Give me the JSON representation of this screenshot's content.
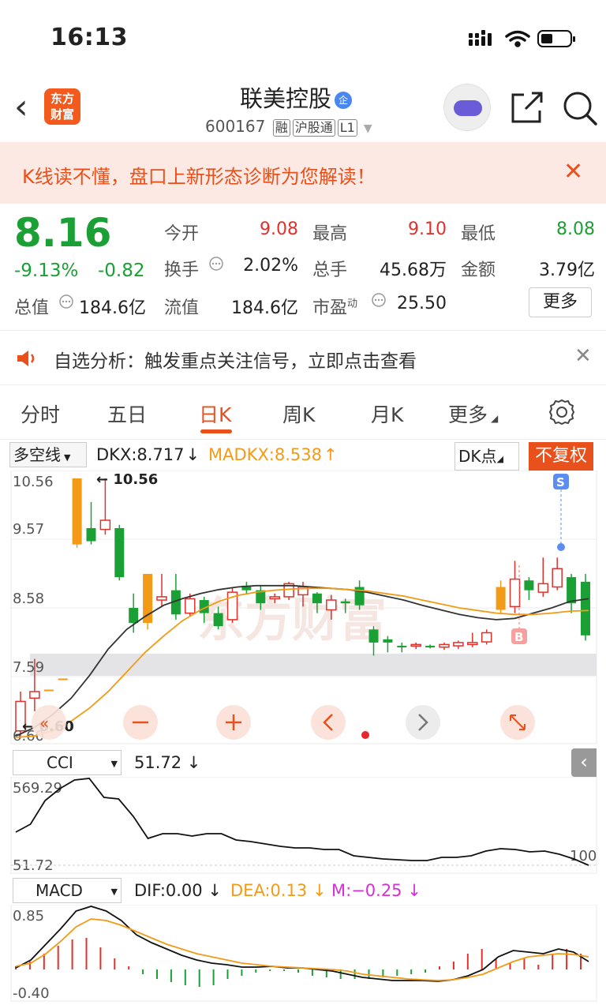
{
  "status": {
    "time": "16:13"
  },
  "nav": {
    "logo_line1": "东方",
    "logo_line2": "财富",
    "stock_name": "联美控股",
    "badge": "企",
    "code": "600167",
    "tags": [
      "融",
      "沪股通",
      "L1"
    ]
  },
  "banner": {
    "text": "K线读不懂，盘口上新形态诊断为您解读！",
    "close": "✕"
  },
  "quote": {
    "price": "8.16",
    "change_pct": "-9.13%",
    "change": "-0.82",
    "market_value_label": "总值",
    "market_value": "184.6亿",
    "fields": [
      {
        "label": "今开",
        "value": "9.08",
        "color": "#e0312b"
      },
      {
        "label": "最高",
        "value": "9.10",
        "color": "#e0312b"
      },
      {
        "label": "最低",
        "value": "8.08",
        "color": "#1aa034"
      },
      {
        "label": "换手",
        "value": "2.02%",
        "color": "#222222"
      },
      {
        "label": "总手",
        "value": "45.68万",
        "color": "#222222"
      },
      {
        "label": "金额",
        "value": "3.79亿",
        "color": "#222222"
      },
      {
        "label": "流值",
        "value": "184.6亿",
        "color": "#222222"
      },
      {
        "label": "市盈",
        "value": "25.50",
        "color": "#222222"
      }
    ],
    "pe_sup": "动",
    "more": "更多"
  },
  "alert": {
    "text": "自选分析：触发重点关注信号，立即点击查看",
    "close": "✕"
  },
  "tabs": [
    "分时",
    "五日",
    "日K",
    "周K",
    "月K",
    "更多"
  ],
  "active_tab": "日K",
  "indicator_bar": {
    "selector": "多空线",
    "dkx": "DKX:8.717",
    "madkx": "MADKX:8.538",
    "dk_point": "DK点",
    "fuquan": "不复权"
  },
  "kline": {
    "y_labels": [
      "10.56",
      "9.57",
      "8.58",
      "7.59",
      "6.60"
    ],
    "high_marker": "10.56",
    "low_marker": "6.60",
    "buy_marker": "B",
    "sell_marker": "S",
    "watermark": "东方财富"
  },
  "cci": {
    "name": "CCI",
    "value": "51.72",
    "max_label": "569.29",
    "min_label": "51.72",
    "ref_label": "100"
  },
  "macd": {
    "name": "MACD",
    "dif": "DIF:0.00",
    "dea": "DEA:0.13",
    "m": "M:−0.25",
    "max_label": "0.85",
    "min_label": "-0.40"
  },
  "colors": {
    "up": "#e0312b",
    "down": "#1aa034",
    "accent": "#e8501c",
    "orange": "#f39a16",
    "magenta": "#d62fd6"
  }
}
